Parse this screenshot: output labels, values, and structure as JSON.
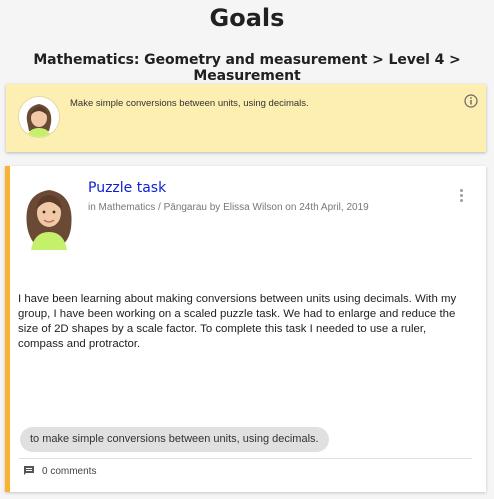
{
  "page": {
    "title": "Goals",
    "breadcrumb": "Mathematics: Geometry and measurement > Level 4 > Measurement"
  },
  "goal_banner": {
    "text": "Make simple conversions between units, using decimals.",
    "icon": "info-icon",
    "background": "#fdeeb1"
  },
  "story": {
    "title": "Puzzle task",
    "meta": "in Mathematics / Pāngarau by Elissa Wilson on 24th April, 2019",
    "body": "I have been learning about making conversions between units using decimals. With my group, I have been working on a scaled puzzle task. We had to enlarge and reduce the size of 2D shapes by a scale factor. To complete this task I needed to use a ruler, compass and protractor.",
    "goal_tag": "to make simple conversions between units, using decimals.",
    "comments": "0 comments",
    "accent_color": "#f9b233",
    "title_color": "#0d1fd1"
  }
}
